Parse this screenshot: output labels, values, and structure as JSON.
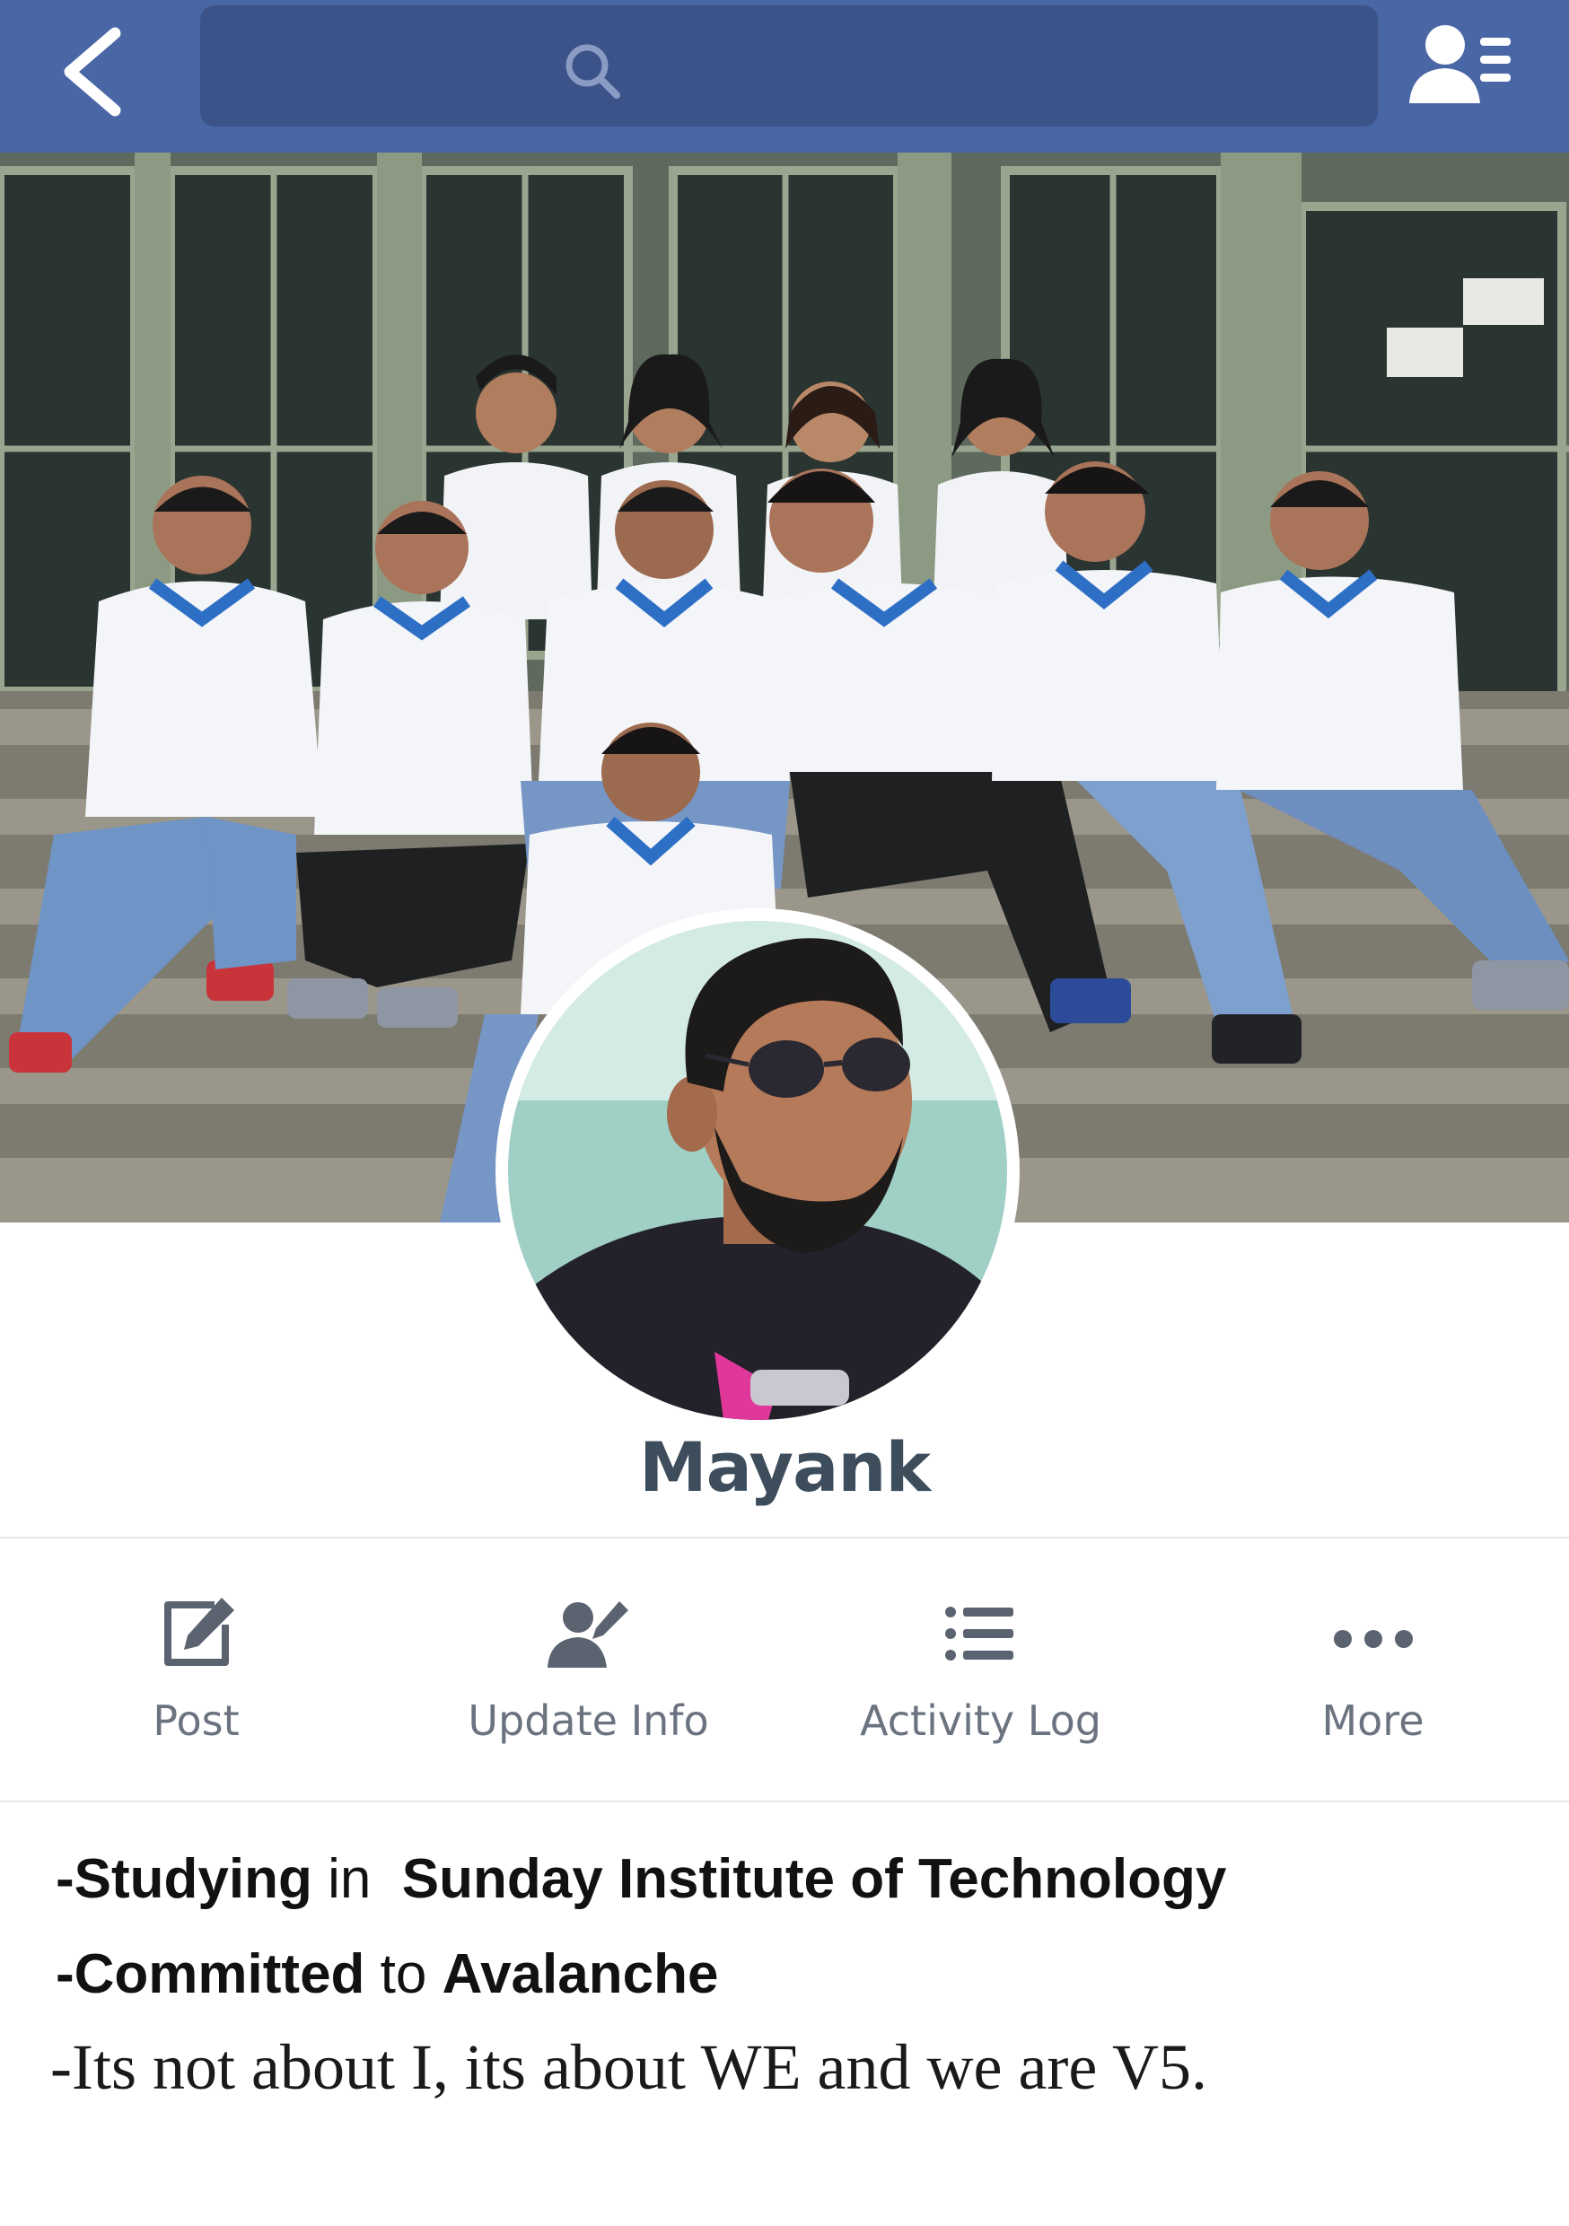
{
  "colors": {
    "topbar": "#4a67a5",
    "searchbox": "#3b5389",
    "name_text": "#3d4d5c",
    "action_text": "#6b7380",
    "action_icon": "#5b6270"
  },
  "topbar": {
    "back_icon": "chevron-left-icon",
    "search_icon": "search-icon",
    "friends_icon": "friend-list-icon"
  },
  "cover": {
    "description_icon": "cover-photo"
  },
  "profile": {
    "name": "Mayank"
  },
  "actions": [
    {
      "label": "Post",
      "icon": "edit-icon"
    },
    {
      "label": "Update Info",
      "icon": "user-edit-icon"
    },
    {
      "label": "Activity Log",
      "icon": "list-icon"
    },
    {
      "label": "More",
      "icon": "more-dots-icon"
    }
  ],
  "bio": {
    "line1": {
      "prefix": "-Studying",
      "mid": " in  ",
      "org": "Sunday Institute of Technology"
    },
    "line2": {
      "prefix": "-Committed",
      "mid": " to ",
      "org": "Avalanche"
    },
    "line3": "-Its not about I, its about WE and we are V5."
  }
}
